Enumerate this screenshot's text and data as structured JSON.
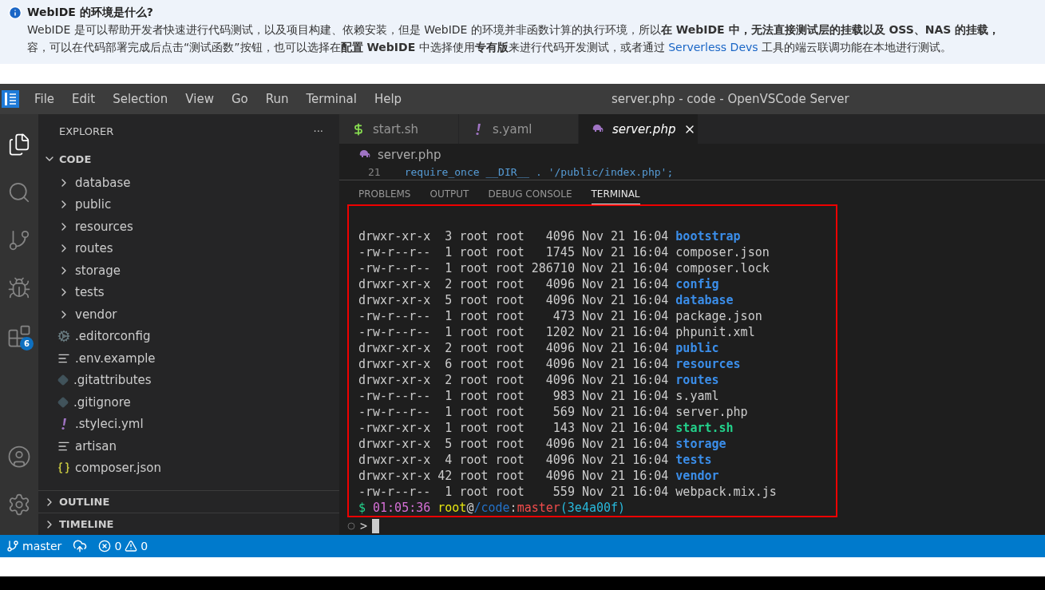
{
  "notice": {
    "title": "WebIDE 的环境是什么?",
    "line_1": "WebIDE 是可以帮助开发者快速进行代码测试，以及项目构建、依赖安装，但是 WebIDE 的环境并非函数计算的执行环境，所以**在 WebIDE 中，无法直接测试层的挂载以及 OSS、NAS 的挂载，**",
    "line_2_before": "容，可以在代码部署完成后点击“测试函数”按钮，也可以选择在**配置 WebIDE** 中选择使用**专有版**来进行代码开发测试，或者通过 ",
    "line_2_link": "Serverless Devs",
    "line_2_after": " 工具的端云联调功能在本地进行测试。"
  },
  "window": {
    "title": "server.php - code - OpenVSCode Server"
  },
  "menu": [
    "File",
    "Edit",
    "Selection",
    "View",
    "Go",
    "Run",
    "Terminal",
    "Help"
  ],
  "activity_bar": [
    {
      "kind": "files",
      "selected": true
    },
    {
      "kind": "search",
      "selected": false
    },
    {
      "kind": "source-control",
      "selected": false
    },
    {
      "kind": "debug",
      "selected": false
    },
    {
      "kind": "extensions",
      "selected": false,
      "badge": "6"
    }
  ],
  "activity_bottom": [
    {
      "kind": "account"
    },
    {
      "kind": "settings"
    }
  ],
  "sidebar": {
    "title": "EXPLORER",
    "more": "···",
    "section": {
      "title": "CODE",
      "expanded": true,
      "items": [
        {
          "kind": "folder",
          "label": "database"
        },
        {
          "kind": "folder",
          "label": "public"
        },
        {
          "kind": "folder",
          "label": "resources"
        },
        {
          "kind": "folder",
          "label": "routes"
        },
        {
          "kind": "folder",
          "label": "storage"
        },
        {
          "kind": "folder",
          "label": "tests"
        },
        {
          "kind": "folder",
          "label": "vendor"
        },
        {
          "kind": "config",
          "label": ".editorconfig"
        },
        {
          "kind": "text",
          "label": ".env.example"
        },
        {
          "kind": "git",
          "label": ".gitattributes"
        },
        {
          "kind": "git",
          "label": ".gitignore"
        },
        {
          "kind": "yaml",
          "label": ".styleci.yml"
        },
        {
          "kind": "text",
          "label": "artisan"
        },
        {
          "kind": "json",
          "label": "composer.json"
        }
      ]
    },
    "collapsed_sections": [
      {
        "title": "OUTLINE",
        "expanded": false
      },
      {
        "title": "TIMELINE",
        "expanded": false
      }
    ]
  },
  "tabs": [
    {
      "kind": "shell",
      "label": "start.sh",
      "selected": false
    },
    {
      "kind": "yaml",
      "label": "s.yaml",
      "selected": false
    },
    {
      "kind": "php",
      "label": "server.php",
      "selected": true
    }
  ],
  "breadcrumb": "server.php",
  "code_line": {
    "number": "21",
    "code": "require_once __DIR__ . '/public/index.php';"
  },
  "panel_tabs": [
    {
      "label": "PROBLEMS",
      "selected": false
    },
    {
      "label": "OUTPUT",
      "selected": false
    },
    {
      "label": "DEBUG CONSOLE",
      "selected": false
    },
    {
      "label": "TERMINAL",
      "selected": true
    }
  ],
  "terminal": {
    "rows": [
      {
        "info": "drwxr-xr-x  3 root root   4096 Nov 21 16:04",
        "name": "bootstrap",
        "kind": "dir"
      },
      {
        "info": "-rw-r--r--  1 root root   1745 Nov 21 16:04",
        "name": "composer.json",
        "kind": "file"
      },
      {
        "info": "-rw-r--r--  1 root root 286710 Nov 21 16:04",
        "name": "composer.lock",
        "kind": "file"
      },
      {
        "info": "drwxr-xr-x  2 root root   4096 Nov 21 16:04",
        "name": "config",
        "kind": "dir"
      },
      {
        "info": "drwxr-xr-x  5 root root   4096 Nov 21 16:04",
        "name": "database",
        "kind": "dir"
      },
      {
        "info": "-rw-r--r--  1 root root    473 Nov 21 16:04",
        "name": "package.json",
        "kind": "file"
      },
      {
        "info": "-rw-r--r--  1 root root   1202 Nov 21 16:04",
        "name": "phpunit.xml",
        "kind": "file"
      },
      {
        "info": "drwxr-xr-x  2 root root   4096 Nov 21 16:04",
        "name": "public",
        "kind": "dir"
      },
      {
        "info": "drwxr-xr-x  6 root root   4096 Nov 21 16:04",
        "name": "resources",
        "kind": "dir"
      },
      {
        "info": "drwxr-xr-x  2 root root   4096 Nov 21 16:04",
        "name": "routes",
        "kind": "dir"
      },
      {
        "info": "-rw-r--r--  1 root root    983 Nov 21 16:04",
        "name": "s.yaml",
        "kind": "file"
      },
      {
        "info": "-rw-r--r--  1 root root    569 Nov 21 16:04",
        "name": "server.php",
        "kind": "file"
      },
      {
        "info": "-rwxr-xr-x  1 root root    143 Nov 21 16:04",
        "name": "start.sh",
        "kind": "exec"
      },
      {
        "info": "drwxr-xr-x  5 root root   4096 Nov 21 16:04",
        "name": "storage",
        "kind": "dir"
      },
      {
        "info": "drwxr-xr-x  4 root root   4096 Nov 21 16:04",
        "name": "tests",
        "kind": "dir"
      },
      {
        "info": "drwxr-xr-x 42 root root   4096 Nov 21 16:04",
        "name": "vendor",
        "kind": "dir"
      },
      {
        "info": "-rw-r--r--  1 root root    559 Nov 21 16:04",
        "name": "webpack.mix.js",
        "kind": "file"
      }
    ],
    "prompt": [
      {
        "text": "$",
        "color": "#23d18b"
      },
      {
        "text": "01:05:36",
        "color": "#d670d6"
      },
      {
        "text": "root",
        "color": "#e5e510"
      },
      {
        "text": "@",
        "color": "#cccccc"
      },
      {
        "text": "/code",
        "color": "#2472c8"
      },
      {
        "text": ":",
        "color": "#cccccc"
      },
      {
        "text": "master",
        "color": "#f14c4c"
      },
      {
        "text": "(3e4a00f)",
        "color": "#29b8db"
      }
    ],
    "input_marker": ">"
  },
  "status_bar": {
    "branch": "master",
    "errors": "0",
    "warnings": "0"
  }
}
